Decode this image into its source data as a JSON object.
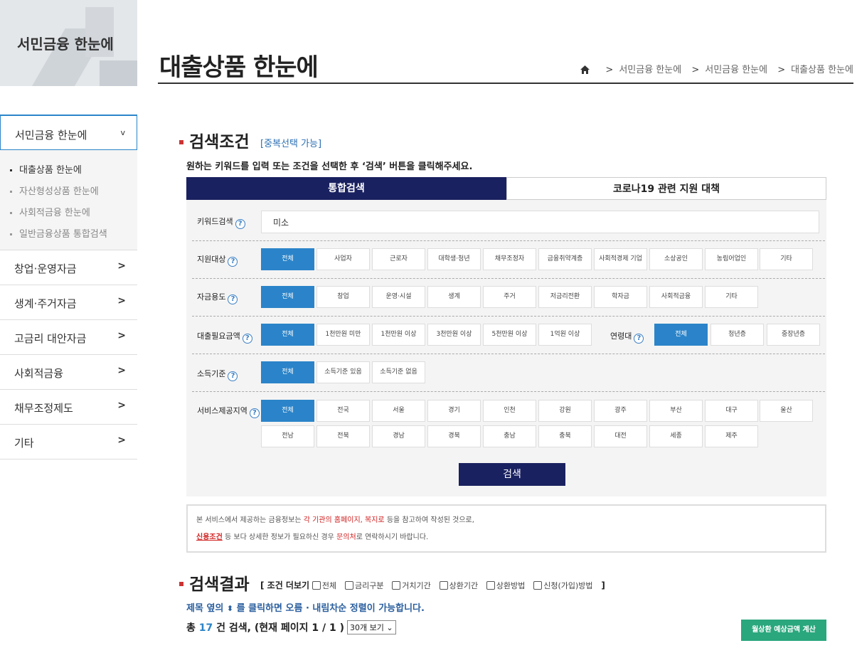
{
  "sidebar": {
    "banner_title": "서민금융 한눈에",
    "active_label": "서민금융 한눈에",
    "active_chev": "v",
    "sub_items": [
      "대출상품 한눈에",
      "자산형성상품 한눈에",
      "사회적금융 한눈에",
      "일반금융상품 통합검색"
    ],
    "menus": [
      {
        "label": "창업·운영자금",
        "arrow": ">"
      },
      {
        "label": "생계·주거자금",
        "arrow": ">"
      },
      {
        "label": "고금리 대안자금",
        "arrow": ">"
      },
      {
        "label": "사회적금융",
        "arrow": ">"
      },
      {
        "label": "채무조정제도",
        "arrow": ">"
      },
      {
        "label": "기타",
        "arrow": ">"
      }
    ]
  },
  "header": {
    "title": "대출상품 한눈에",
    "breadcrumb": [
      "서민금융 한눈에",
      "서민금융 한눈에",
      "대출상품 한눈에"
    ],
    "breadcrumb_sep": ">"
  },
  "search": {
    "title": "검색조건",
    "note": "[중복선택 가능]",
    "instruction": "원하는 키워드를 입력 또는 조건을 선택한 후 ‘검색’ 버튼을 클릭해주세요.",
    "tabs": [
      "통합검색",
      "코로나19 관련 지원 대책"
    ],
    "help": "?",
    "keyword_label": "키워드검색",
    "keyword_value": "미소",
    "target_label": "지원대상",
    "target_options": [
      "전체",
      "사업자",
      "근로자",
      "대학생·청년",
      "채무조정자",
      "금융취약계층",
      "사회적경제 기업",
      "소상공인",
      "농림어업인",
      "기타"
    ],
    "use_label": "자금용도",
    "use_options": [
      "전체",
      "창업",
      "운영·시설",
      "생계",
      "주거",
      "저금리전환",
      "학자금",
      "사회적금융",
      "기타"
    ],
    "amount_label": "대출필요금액",
    "amount_options": [
      "전체",
      "1천만원 미만",
      "1천만원 이상",
      "3천만원 이상",
      "5천만원 이상",
      "1억원 이상"
    ],
    "age_label": "연령대",
    "age_options": [
      "전체",
      "청년층",
      "중장년층"
    ],
    "income_label": "소득기준",
    "income_options": [
      "전체",
      "소득기준 있음",
      "소득기준 없음"
    ],
    "region_label": "서비스제공지역",
    "region_options": [
      "전체",
      "전국",
      "서울",
      "경기",
      "인천",
      "강원",
      "광주",
      "부산",
      "대구",
      "울산",
      "전남",
      "전북",
      "경남",
      "경북",
      "충남",
      "충북",
      "대전",
      "세종",
      "제주"
    ],
    "button": "검색"
  },
  "notice": {
    "l1a": "본 서비스에서 제공하는 금융정보는 ",
    "l1b": "각 기관의 홈페이지, 복지로",
    "l1c": " 등을 참고하여 작성된 것으로,",
    "l2a": "신용조건",
    "l2b": " 등 보다 상세한 정보가 필요하신 경우 ",
    "l2c": "문의처",
    "l2d": "로 연락하시기 바랍니다."
  },
  "results": {
    "title": "검색결과",
    "cond_open": "[ 조건 더보기",
    "cond_close": "]",
    "cond_items": [
      "전체",
      "금리구분",
      "거치기간",
      "상환기간",
      "상환방법",
      "신청(가입)방법"
    ],
    "sort_a": "제목 옆의",
    "sort_icon": "⬍",
    "sort_b": "를 클릭하면 오름 · 내림차순 정렬이 가능합니다.",
    "total_prefix": "총",
    "total_count": "17",
    "total_suffix": "건 검색, (현재 페이지 1 / 1 )",
    "per_page": "30개 보기",
    "calc_button": "월상환 예상금액 계산"
  }
}
